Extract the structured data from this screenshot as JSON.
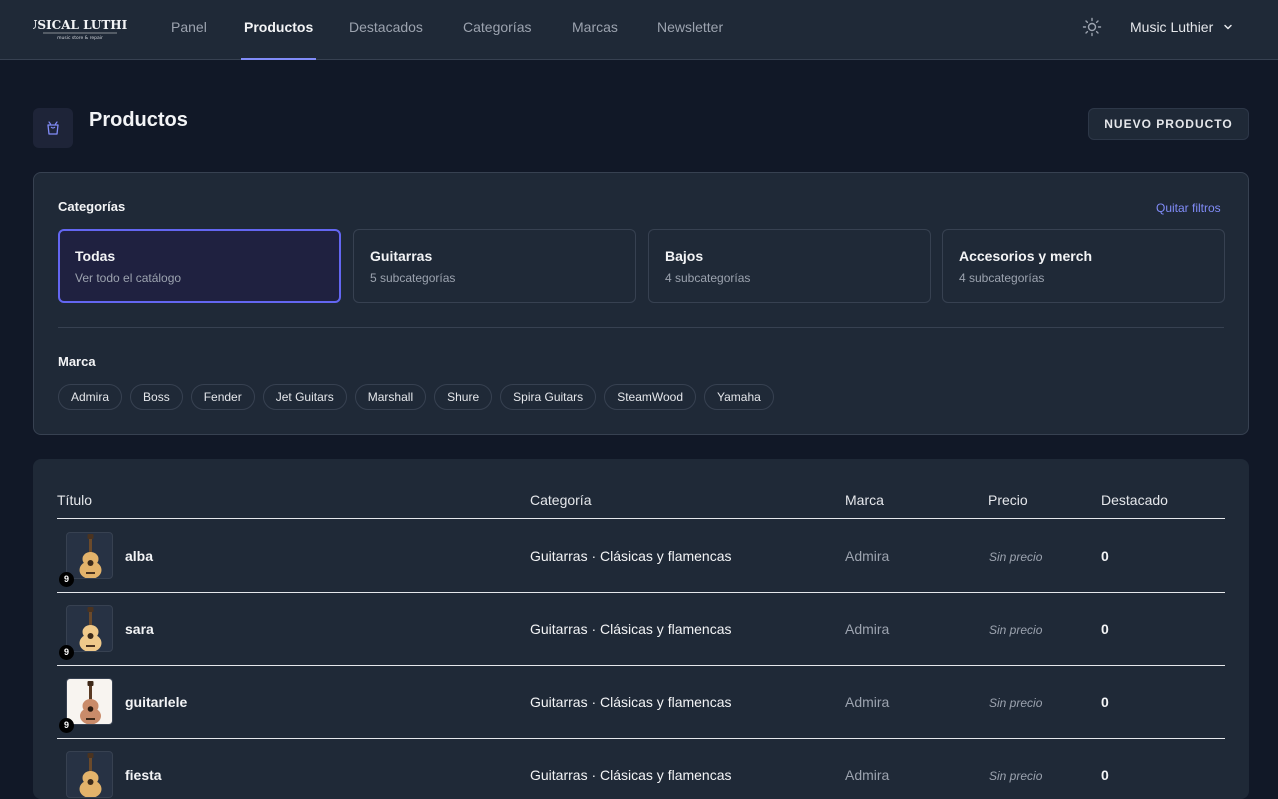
{
  "brand": {
    "logo_text": "MUSICAL LUTHIER",
    "logo_sub": "music store & repair"
  },
  "nav": {
    "items": [
      {
        "label": "Panel"
      },
      {
        "label": "Productos"
      },
      {
        "label": "Destacados"
      },
      {
        "label": "Categorías"
      },
      {
        "label": "Marcas"
      },
      {
        "label": "Newsletter"
      }
    ],
    "active": "Productos",
    "user": "Music Luthier"
  },
  "header": {
    "title": "Productos",
    "new_button": "NUEVO PRODUCTO"
  },
  "filters": {
    "categories_label": "Categorías",
    "clear_label": "Quitar filtros",
    "categories": [
      {
        "name": "Todas",
        "sub": "Ver todo el catálogo"
      },
      {
        "name": "Guitarras",
        "sub": "5 subcategorías"
      },
      {
        "name": "Bajos",
        "sub": "4 subcategorías"
      },
      {
        "name": "Accesorios y merch",
        "sub": "4 subcategorías"
      }
    ],
    "brand_label": "Marca",
    "brands": [
      "Admira",
      "Boss",
      "Fender",
      "Jet Guitars",
      "Marshall",
      "Shure",
      "Spira Guitars",
      "SteamWood",
      "Yamaha"
    ]
  },
  "table": {
    "headers": {
      "title": "Título",
      "category": "Categoría",
      "brand": "Marca",
      "price": "Precio",
      "featured": "Destacado"
    },
    "rows": [
      {
        "title": "alba",
        "badge": "9",
        "category": "Guitarras · Clásicas y flamencas",
        "brand": "Admira",
        "price": "Sin precio",
        "featured": "0"
      },
      {
        "title": "sara",
        "badge": "9",
        "category": "Guitarras · Clásicas y flamencas",
        "brand": "Admira",
        "price": "Sin precio",
        "featured": "0"
      },
      {
        "title": "guitarlele",
        "badge": "9",
        "category": "Guitarras · Clásicas y flamencas",
        "brand": "Admira",
        "price": "Sin precio",
        "featured": "0"
      },
      {
        "title": "fiesta",
        "badge": "",
        "category": "Guitarras · Clásicas y flamencas",
        "brand": "Admira",
        "price": "Sin precio",
        "featured": "0"
      }
    ]
  },
  "colors": {
    "accent": "#6366f1",
    "background": "#111827",
    "surface": "#1f2937"
  }
}
